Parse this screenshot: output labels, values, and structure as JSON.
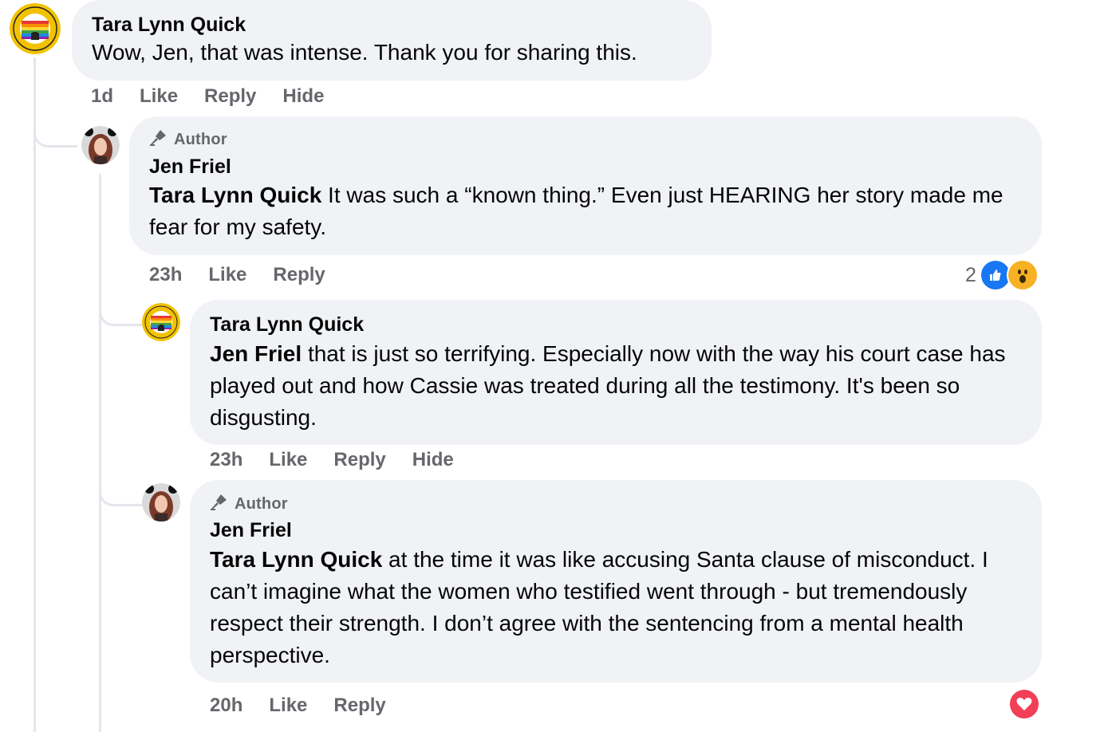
{
  "comments": [
    {
      "author_name": "Tara Lynn Quick",
      "text": "Wow, Jen, that was intense. Thank you for sharing this.",
      "time": "1d",
      "actions": [
        "Like",
        "Reply",
        "Hide"
      ]
    },
    {
      "badge": "Author",
      "author_name": "Jen Friel",
      "mention": "Tara Lynn Quick",
      "text": " It was such a “known thing.” Even just HEARING her story made me fear for my safety.",
      "time": "23h",
      "actions": [
        "Like",
        "Reply"
      ],
      "reaction_count": "2",
      "reactions": [
        "like-icon",
        "wow-icon"
      ]
    },
    {
      "author_name": "Tara Lynn Quick",
      "mention": "Jen Friel",
      "text": " that is just so terrifying. Especially now with the way his court case has played out and how Cassie was treated during all the testimony. It's been so disgusting.",
      "time": "23h",
      "actions": [
        "Like",
        "Reply",
        "Hide"
      ]
    },
    {
      "badge": "Author",
      "author_name": "Jen Friel",
      "mention": "Tara Lynn Quick",
      "text": " at the time it was like accusing Santa clause of misconduct. I can’t imagine what the women who testified went through - but tremendously respect their strength. I don’t agree with the sentencing from a mental health perspective.",
      "time": "20h",
      "actions": [
        "Like",
        "Reply"
      ],
      "reactions": [
        "love-icon"
      ]
    }
  ],
  "colors": {
    "bubble": "#f0f2f5",
    "meta": "#65676b",
    "like": "#1877f2",
    "love": "#f33e58",
    "wow": "#f7b125",
    "thread_line": "#e4e6eb"
  }
}
